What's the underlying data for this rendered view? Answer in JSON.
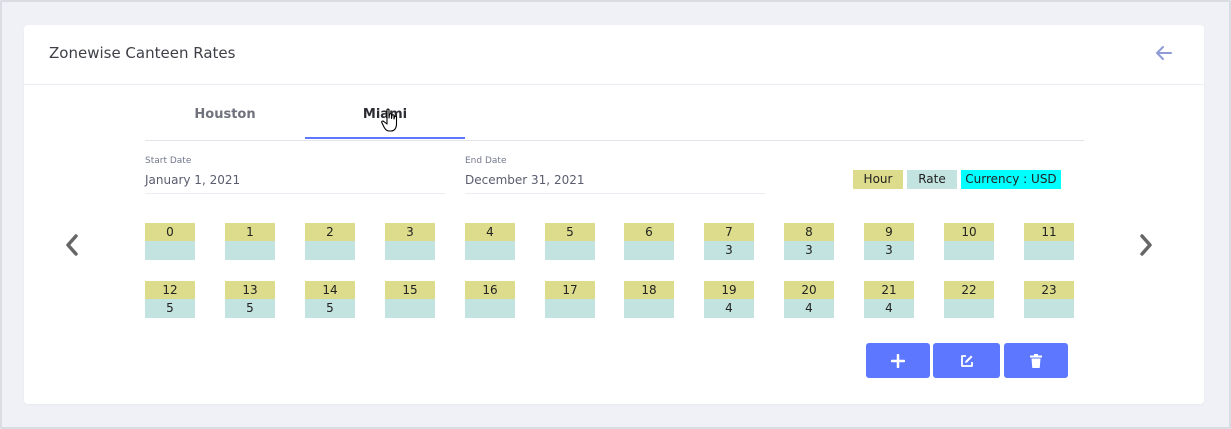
{
  "page": {
    "title": "Zonewise Canteen Rates"
  },
  "tabs": [
    {
      "label": "Houston",
      "active": false
    },
    {
      "label": "Miami",
      "active": true
    }
  ],
  "start_date": {
    "label": "Start Date",
    "value": "January 1, 2021"
  },
  "end_date": {
    "label": "End Date",
    "value": "December 31, 2021"
  },
  "legend": {
    "hour": "Hour",
    "rate": "Rate",
    "currency": "Currency : USD"
  },
  "colors": {
    "accent": "#5d78ff",
    "hour_bg": "#dcdc8c",
    "rate_bg": "#c2e3df",
    "currency_bg": "#00ffff"
  },
  "hours": [
    {
      "hour": "0",
      "rate": ""
    },
    {
      "hour": "1",
      "rate": ""
    },
    {
      "hour": "2",
      "rate": ""
    },
    {
      "hour": "3",
      "rate": ""
    },
    {
      "hour": "4",
      "rate": ""
    },
    {
      "hour": "5",
      "rate": ""
    },
    {
      "hour": "6",
      "rate": ""
    },
    {
      "hour": "7",
      "rate": "3"
    },
    {
      "hour": "8",
      "rate": "3"
    },
    {
      "hour": "9",
      "rate": "3"
    },
    {
      "hour": "10",
      "rate": ""
    },
    {
      "hour": "11",
      "rate": ""
    },
    {
      "hour": "12",
      "rate": "5"
    },
    {
      "hour": "13",
      "rate": "5"
    },
    {
      "hour": "14",
      "rate": "5"
    },
    {
      "hour": "15",
      "rate": ""
    },
    {
      "hour": "16",
      "rate": ""
    },
    {
      "hour": "17",
      "rate": ""
    },
    {
      "hour": "18",
      "rate": ""
    },
    {
      "hour": "19",
      "rate": "4"
    },
    {
      "hour": "20",
      "rate": "4"
    },
    {
      "hour": "21",
      "rate": "4"
    },
    {
      "hour": "22",
      "rate": ""
    },
    {
      "hour": "23",
      "rate": ""
    }
  ],
  "icons": {
    "back": "arrow-left-icon",
    "prev": "chevron-left-icon",
    "next": "chevron-right-icon",
    "add": "plus-icon",
    "edit": "edit-icon",
    "delete": "trash-icon"
  }
}
